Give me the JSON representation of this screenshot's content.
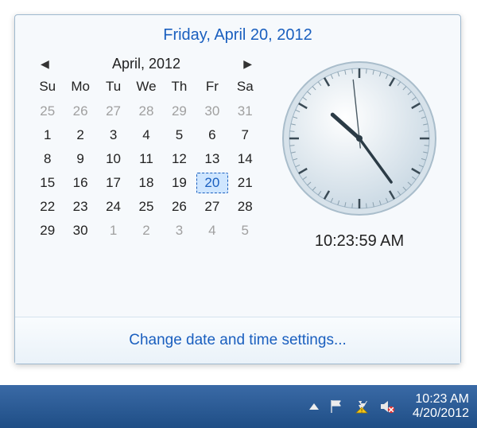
{
  "header": {
    "full_date": "Friday, April 20, 2012"
  },
  "calendar": {
    "month_label": "April, 2012",
    "dow": [
      "Su",
      "Mo",
      "Tu",
      "We",
      "Th",
      "Fr",
      "Sa"
    ],
    "cells": [
      {
        "n": 25,
        "dim": true
      },
      {
        "n": 26,
        "dim": true
      },
      {
        "n": 27,
        "dim": true
      },
      {
        "n": 28,
        "dim": true
      },
      {
        "n": 29,
        "dim": true
      },
      {
        "n": 30,
        "dim": true
      },
      {
        "n": 31,
        "dim": true
      },
      {
        "n": 1
      },
      {
        "n": 2
      },
      {
        "n": 3
      },
      {
        "n": 4
      },
      {
        "n": 5
      },
      {
        "n": 6
      },
      {
        "n": 7
      },
      {
        "n": 8
      },
      {
        "n": 9
      },
      {
        "n": 10
      },
      {
        "n": 11
      },
      {
        "n": 12
      },
      {
        "n": 13
      },
      {
        "n": 14
      },
      {
        "n": 15
      },
      {
        "n": 16
      },
      {
        "n": 17
      },
      {
        "n": 18
      },
      {
        "n": 19
      },
      {
        "n": 20,
        "selected": true
      },
      {
        "n": 21
      },
      {
        "n": 22
      },
      {
        "n": 23
      },
      {
        "n": 24
      },
      {
        "n": 25
      },
      {
        "n": 26
      },
      {
        "n": 27
      },
      {
        "n": 28
      },
      {
        "n": 29
      },
      {
        "n": 30
      },
      {
        "n": 1,
        "dim": true
      },
      {
        "n": 2,
        "dim": true
      },
      {
        "n": 3,
        "dim": true
      },
      {
        "n": 4,
        "dim": true
      },
      {
        "n": 5,
        "dim": true
      }
    ]
  },
  "clock": {
    "digital": "10:23:59 AM",
    "hour": 10,
    "minute": 23,
    "second": 59
  },
  "footer": {
    "link": "Change date and time settings..."
  },
  "taskbar": {
    "time": "10:23 AM",
    "date": "4/20/2012"
  }
}
